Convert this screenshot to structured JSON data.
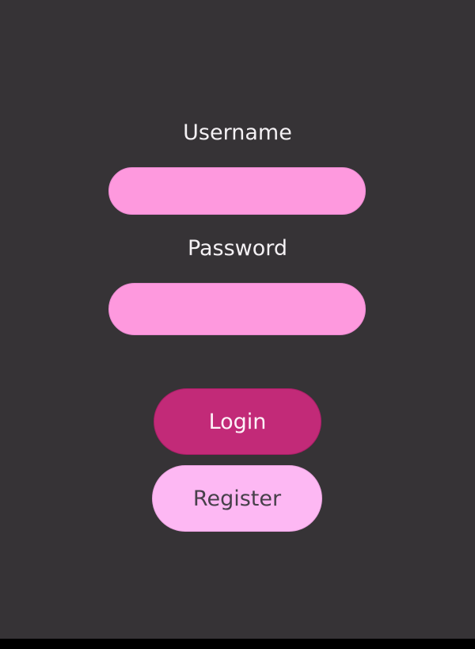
{
  "login_form": {
    "username_label": "Username",
    "username_value": "",
    "password_label": "Password",
    "password_value": "",
    "login_label": "Login",
    "register_label": "Register"
  },
  "colors": {
    "background": "#363336",
    "field_fill": "#fe99de",
    "login_button": "#c22a78",
    "register_button": "#fdb8f3",
    "label_text": "#f4f1f4"
  }
}
